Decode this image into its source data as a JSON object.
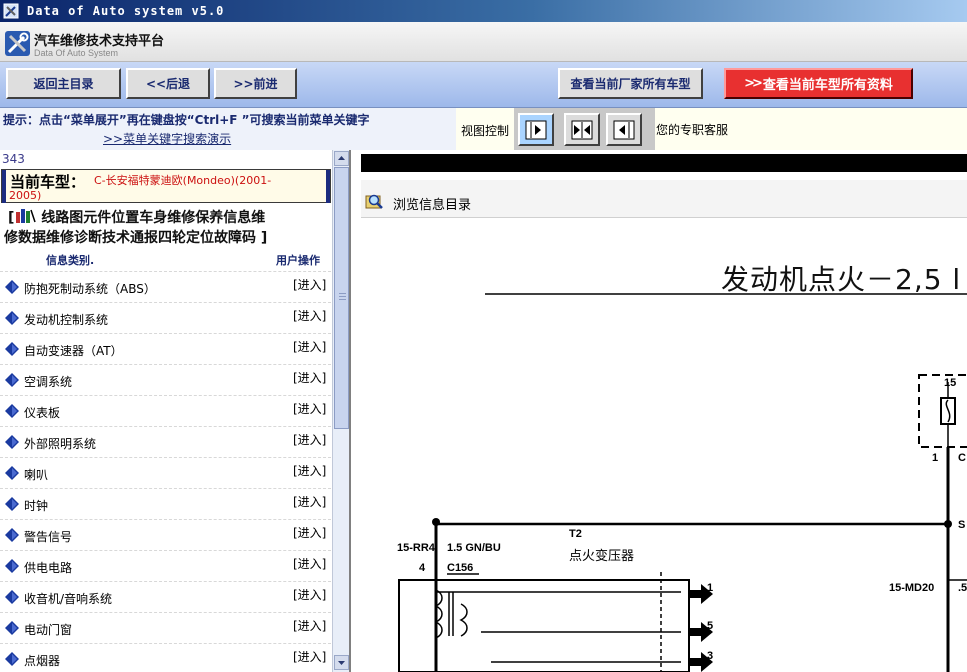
{
  "window": {
    "title": "Data of Auto system v5.0"
  },
  "brand": {
    "name_cn": "汽车维修技术支持平台",
    "name_en": "Data Of Auto System"
  },
  "nav": {
    "home": "返回主目录",
    "back": "<<后退",
    "forward": ">>前进",
    "all_models": "查看当前厂家所有车型",
    "all_data": "查看当前车型所有资料"
  },
  "hint": {
    "line1": "提示：点击“菜单展开”再在键盘按“Ctrl+F ”可搜索当前菜单关键字",
    "demo_link": ">>菜单关键字搜索演示",
    "view_control": "视图控制",
    "service": "您的专职客服"
  },
  "left": {
    "count": "343",
    "current_car_label": "当前车型：",
    "current_car_value_l1": "C-长安福特蒙迪欧(Mondeo)(2001-",
    "current_car_value_l2": "2005)",
    "nav_line_1": "线路图元件位置车身维修保养信息维",
    "nav_line_2": "修数据维修诊断技术通报四轮定位故障码",
    "col_category": "信息类别.",
    "col_action": "用户操作",
    "enter_label": "[进入]",
    "items": [
      "防抱死制动系统（ABS）",
      "发动机控制系统",
      "自动变速器（AT）",
      "空调系统",
      "仪表板",
      "外部照明系统",
      "喇叭",
      "时钟",
      "警告信号",
      "供电电路",
      "收音机/音响系统",
      "电动门窗",
      "点烟器"
    ]
  },
  "right": {
    "browse_label": "浏览信息目录",
    "diagram": {
      "title": "发动机点火－2,5 l",
      "labels": {
        "t2": "T2",
        "ignition_coil": "点火变压器",
        "rr4": "15-RR4",
        "pin4": "4",
        "wire": "1.5 GN/BU",
        "c156": "C156",
        "md20": "15-MD20",
        "n15": "15",
        "n1": "1",
        "c_right": "C",
        "s_right": "S",
        "dot5": ".5",
        "arrow1": "1",
        "arrow5": "5",
        "arrow3": "3"
      }
    }
  },
  "colors": {
    "title_bar": "#0a246a",
    "nav_bar": "#9db8ea",
    "red_button": "#e83030",
    "nav_text": "#1a2a70",
    "car_value": "#cc1010"
  }
}
